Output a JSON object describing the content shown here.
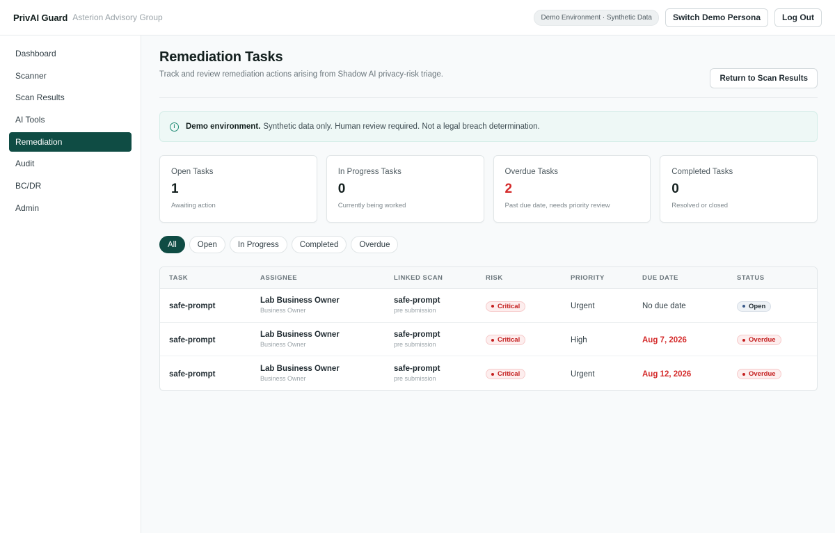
{
  "header": {
    "brand": "PrivAI Guard",
    "org": "Asterion Advisory Group",
    "env_label": "Demo Environment · Synthetic Data",
    "switch_persona": "Switch Demo Persona",
    "logout": "Log Out"
  },
  "sidebar": {
    "items": [
      {
        "label": "Dashboard"
      },
      {
        "label": "Scanner"
      },
      {
        "label": "Scan Results"
      },
      {
        "label": "AI Tools"
      },
      {
        "label": "Remediation",
        "active": true
      },
      {
        "label": "Audit"
      },
      {
        "label": "BC/DR"
      },
      {
        "label": "Admin"
      }
    ]
  },
  "page": {
    "title": "Remediation Tasks",
    "subtitle": "Track and review remediation actions arising from Shadow AI privacy-risk triage.",
    "return_button": "Return to Scan Results"
  },
  "notice": {
    "bold": "Demo environment.",
    "text": "Synthetic data only. Human review required. Not a legal breach determination."
  },
  "cards": [
    {
      "label": "Open Tasks",
      "value": "1",
      "note": "Awaiting action"
    },
    {
      "label": "In Progress Tasks",
      "value": "0",
      "note": "Currently being worked"
    },
    {
      "label": "Overdue Tasks",
      "value": "2",
      "note": "Past due date, needs priority review"
    },
    {
      "label": "Completed Tasks",
      "value": "0",
      "note": "Resolved or closed"
    }
  ],
  "filters": [
    {
      "label": "All",
      "active": true
    },
    {
      "label": "Open"
    },
    {
      "label": "In Progress"
    },
    {
      "label": "Completed"
    },
    {
      "label": "Overdue"
    }
  ],
  "table": {
    "columns": [
      "Task",
      "Assignee",
      "Linked Scan",
      "Risk",
      "Priority",
      "Due Date",
      "Status"
    ],
    "rows": [
      {
        "task": "safe-prompt",
        "assignee": "Lab Business Owner",
        "assignee_role": "Business Owner",
        "scan": "safe-prompt",
        "scan_stage": "pre submission",
        "risk": "Critical",
        "priority": "Urgent",
        "due": "No due date",
        "status": "Open"
      },
      {
        "task": "safe-prompt",
        "assignee": "Lab Business Owner",
        "assignee_role": "Business Owner",
        "scan": "safe-prompt",
        "scan_stage": "pre submission",
        "risk": "Critical",
        "priority": "High",
        "due": "Aug 7, 2026",
        "status": "Overdue"
      },
      {
        "task": "safe-prompt",
        "assignee": "Lab Business Owner",
        "assignee_role": "Business Owner",
        "scan": "safe-prompt",
        "scan_stage": "pre submission",
        "risk": "Critical",
        "priority": "Urgent",
        "due": "Aug 12, 2026",
        "status": "Overdue"
      }
    ]
  },
  "colors": {
    "accent": "#0f4c44",
    "danger": "#d42a2a"
  }
}
